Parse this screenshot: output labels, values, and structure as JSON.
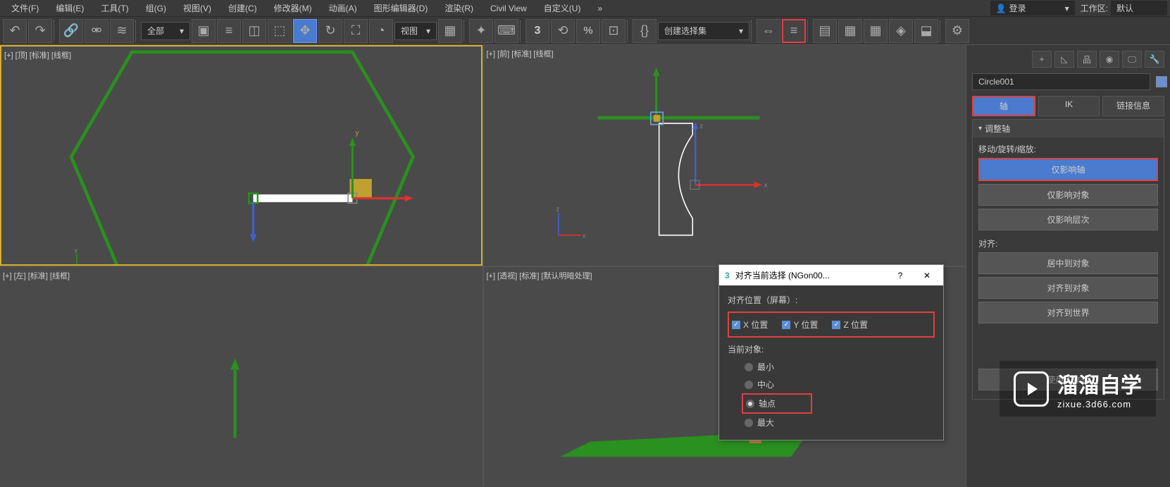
{
  "menu": {
    "items": [
      "文件(F)",
      "编辑(E)",
      "工具(T)",
      "组(G)",
      "视图(V)",
      "创建(C)",
      "修改器(M)",
      "动画(A)",
      "图形编辑器(D)",
      "渲染(R)",
      "Civil View",
      "自定义(U)"
    ],
    "arrow": "»",
    "login_icon": "👤",
    "login": "登录",
    "dropdown_arrow": "▾",
    "workspace_label": "工作区:",
    "workspace_value": "默认"
  },
  "toolbar": {
    "dropdown1": "全部",
    "dropdown2": "视图",
    "selection_set": "创建选择集"
  },
  "viewports": {
    "vp1": "[+] [顶] [标准] [线框]",
    "vp2": "[+] [前] [标准] [线框]",
    "vp3": "[+] [左] [标准] [线框]",
    "vp4": "[+] [透视] [标准] [默认明暗处理]",
    "axis_x": "x",
    "axis_y": "y",
    "axis_z": "z"
  },
  "panel": {
    "object_name": "Circle001",
    "tabs": {
      "pivot": "轴",
      "ik": "IK",
      "link": "链接信息"
    },
    "section_title": "调整轴",
    "move_label": "移动/旋转/缩放:",
    "btn_affect_pivot": "仅影响轴",
    "btn_affect_object": "仅影响对象",
    "btn_affect_hierarchy": "仅影响层次",
    "align_label": "对齐:",
    "btn_center_object": "居中到对象",
    "btn_align_object": "对齐到对象",
    "btn_align_world": "对齐到世界",
    "working_pivot": "使用工作轴"
  },
  "dialog": {
    "logo": "3",
    "title": "对齐当前选择 (NGon00...",
    "help": "?",
    "close": "✕",
    "position_label": "对齐位置（屏幕）:",
    "x_pos": "X 位置",
    "y_pos": "Y 位置",
    "z_pos": "Z 位置",
    "check": "✓",
    "current_label": "当前对象:",
    "radio_min": "最小",
    "radio_center": "中心",
    "radio_pivot": "轴点",
    "radio_max": "最大"
  },
  "watermark": {
    "title": "溜溜自学",
    "url": "zixue.3d66.com"
  }
}
